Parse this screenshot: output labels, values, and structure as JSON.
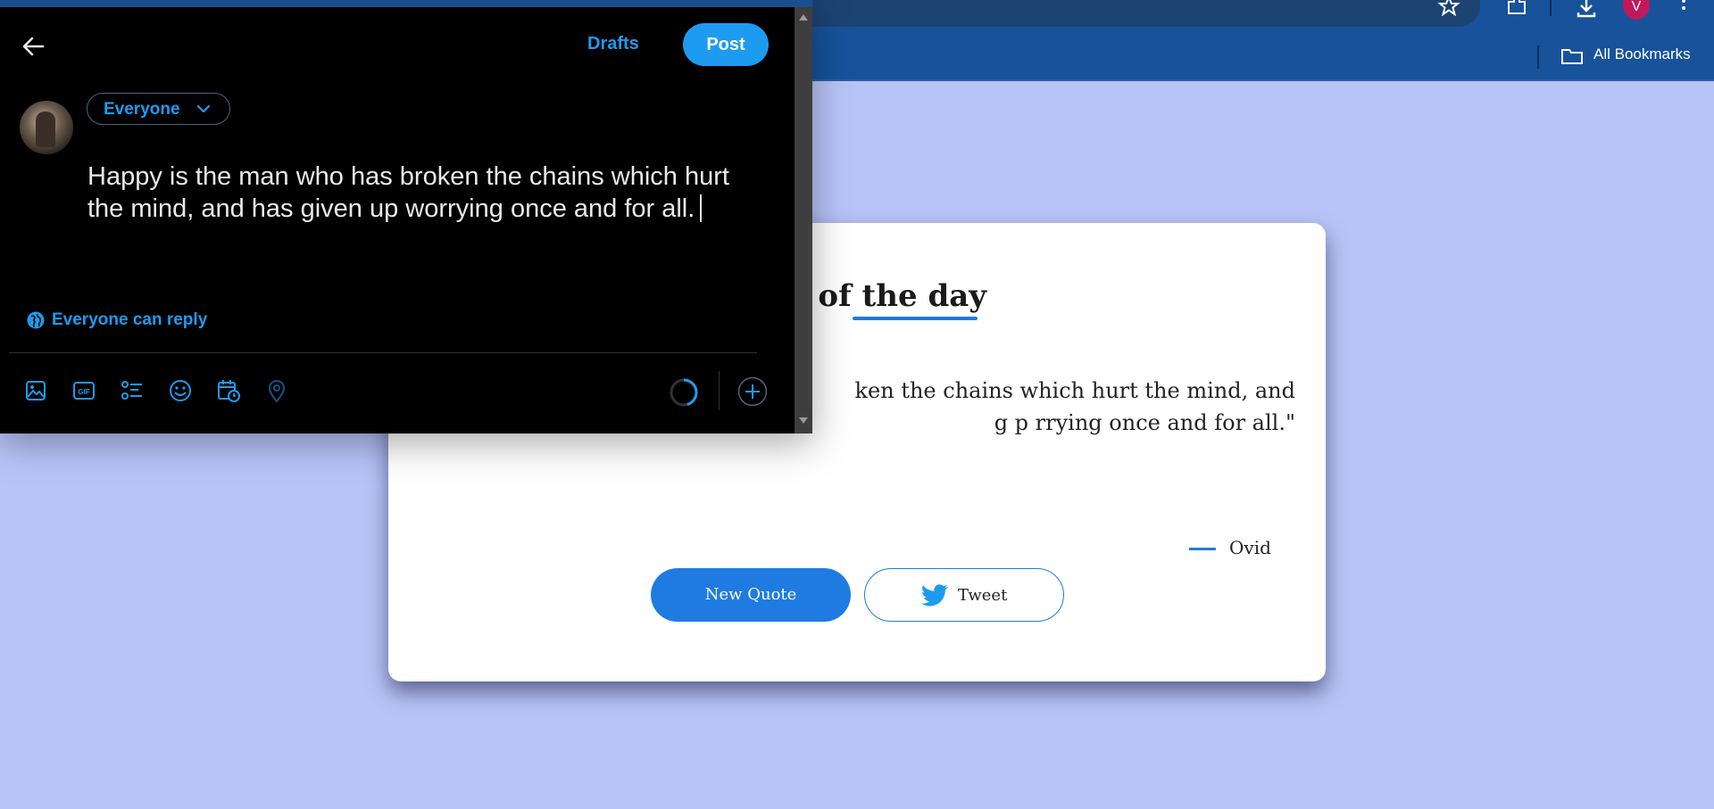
{
  "browser": {
    "bookmarks_label": "All Bookmarks",
    "profile_initial": "V",
    "icons": [
      "star-icon",
      "extensions-icon",
      "download-icon",
      "more-vert-icon",
      "folder-icon"
    ]
  },
  "quote_card": {
    "title": "e of the day",
    "quote": "ken the chains which hurt the mind, and\ng   p   rrying once and for all.\"",
    "author": "Ovid",
    "new_quote_label": "New Quote",
    "tweet_label": "Tweet",
    "accent_color": "#1f7be2"
  },
  "compose": {
    "drafts_label": "Drafts",
    "post_label": "Post",
    "audience_label": "Everyone",
    "text": "Happy is the man who has broken the chains which hurt the mind, and has given up worrying once and for all.",
    "reply_setting": "Everyone can reply",
    "accent_color": "#1d9bf0",
    "toolbar_icons": [
      "media-icon",
      "gif-icon",
      "poll-icon",
      "emoji-icon",
      "schedule-icon",
      "location-icon"
    ]
  }
}
